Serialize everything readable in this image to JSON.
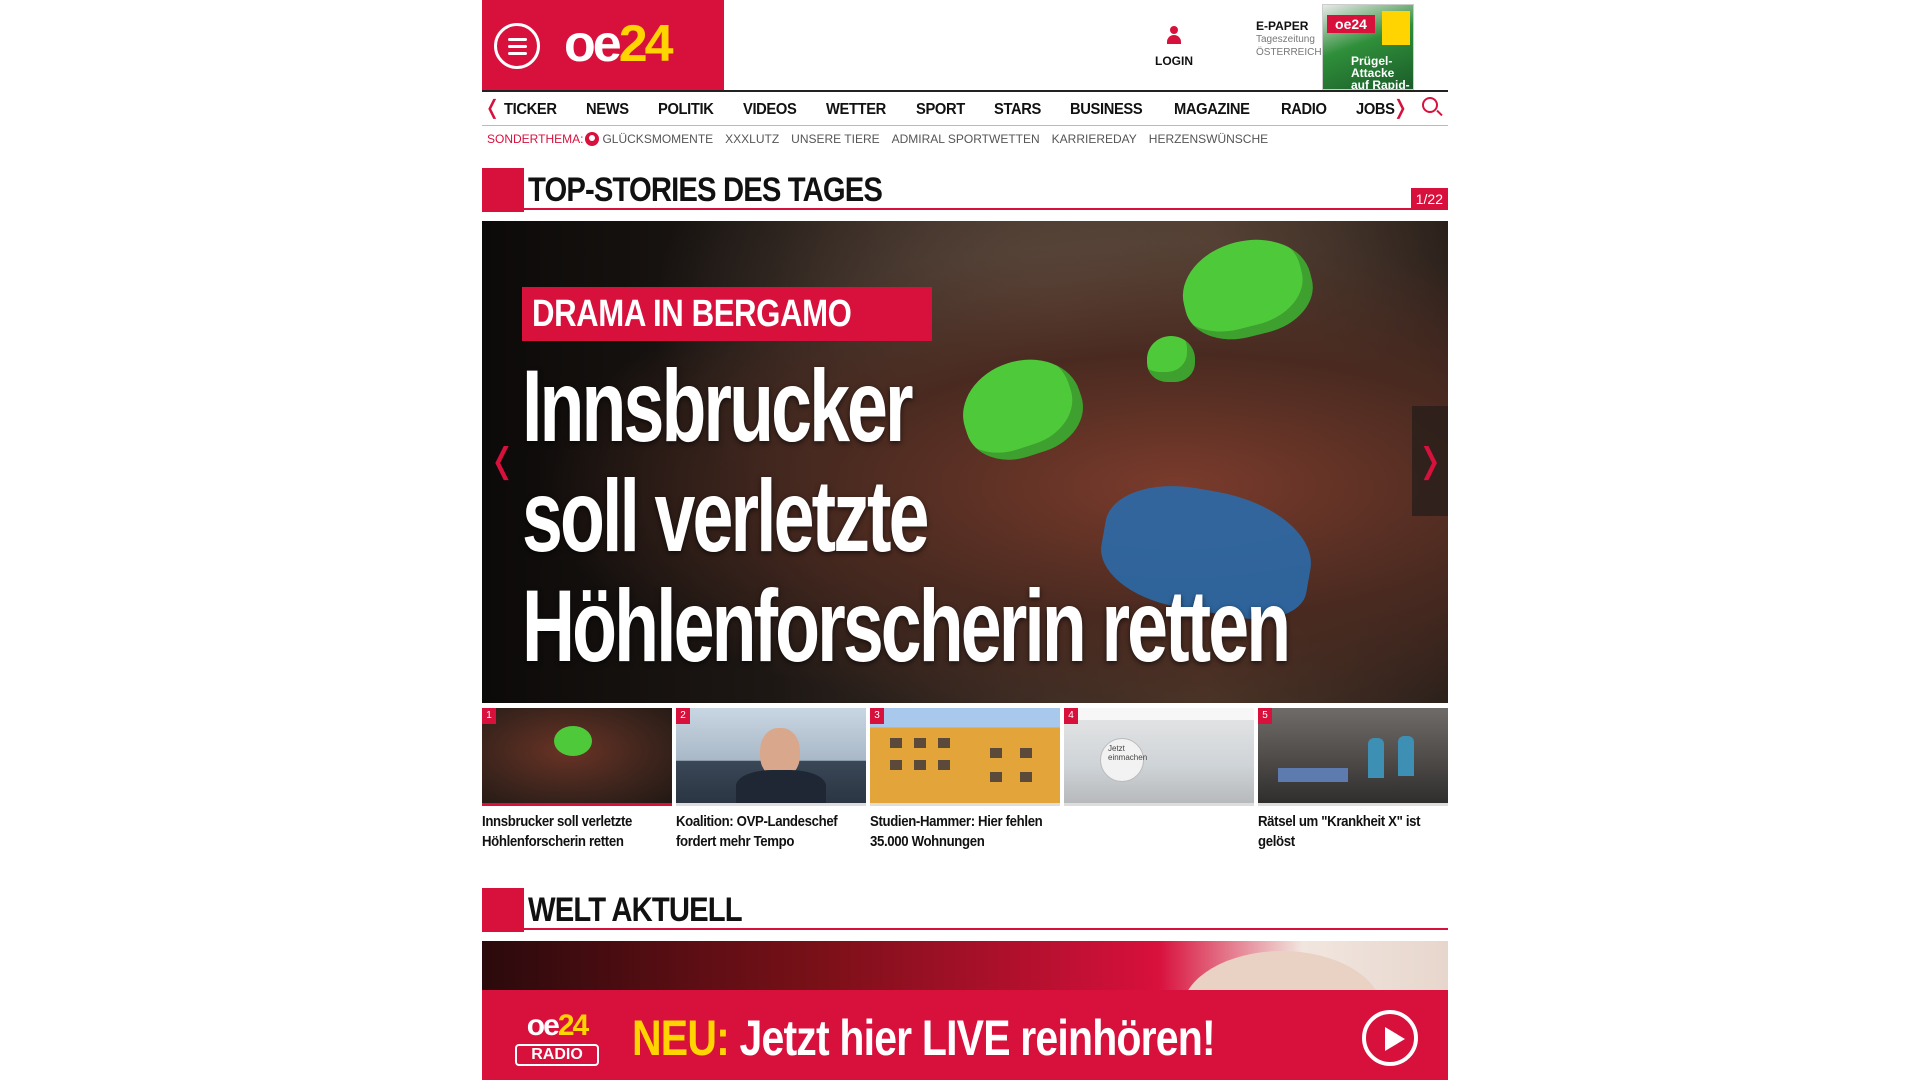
{
  "brand": {
    "logo_text": "oe",
    "logo_num": "24",
    "accent": "#d8103c",
    "logo_num_color": "#ffd400"
  },
  "header": {
    "menu_icon": "hamburger-menu-icon",
    "login_label": "LOGIN",
    "login_icon": "user-icon",
    "epaper": {
      "title": "E-PAPER",
      "subtitle": "Tageszeitung",
      "country": "ÖSTERREICH",
      "cover_mast": "oe24",
      "cover_headline": "Prügel-Attacke auf Rapid-Star"
    }
  },
  "nav": {
    "items": [
      "TICKER",
      "NEWS",
      "POLITIK",
      "VIDEOS",
      "WETTER",
      "SPORT",
      "STARS",
      "BUSINESS",
      "MAGAZINE",
      "RADIO",
      "JOBS"
    ],
    "prev_icon": "chevron-left-icon",
    "next_icon": "chevron-right-icon",
    "search_icon": "search-icon"
  },
  "subnav": {
    "label": "SONDERTHEMA:",
    "items": [
      "GLÜCKSMOMENTE",
      "XXXLUTZ",
      "UNSERE TIERE",
      "ADMIRAL SPORTWETTEN",
      "KARRIEREDAY",
      "HERZENSWÜNSCHE"
    ]
  },
  "top_stories": {
    "title": "TOP-STORIES DES TAGES",
    "counter": "1/22",
    "hero": {
      "kicker": "DRAMA IN BERGAMO",
      "title_lines": [
        "Innsbrucker",
        "soll verletzte",
        "Höhlenforscherin retten"
      ]
    },
    "thumbs": [
      {
        "num": "1",
        "caption_1": "Innsbrucker soll verletzte",
        "caption_2": "Höhlenforscherin retten"
      },
      {
        "num": "2",
        "caption_1": "Koalition: OVP-Landeschef",
        "caption_2": "fordert mehr Tempo"
      },
      {
        "num": "3",
        "caption_1": "Studien-Hammer: Hier fehlen",
        "caption_2": "35.000 Wohnungen"
      },
      {
        "num": "4",
        "caption_1": "",
        "caption_2": "",
        "image_text": "Jetzt einmachen"
      },
      {
        "num": "5",
        "caption_1": "Rätsel um \"Krankheit X\" ist",
        "caption_2": "gelöst"
      }
    ]
  },
  "welt": {
    "title": "WELT AKTUELL"
  },
  "radio_banner": {
    "logo_text": "oe",
    "logo_num": "24",
    "logo_badge": "RADIO",
    "neu": "NEU:",
    "text": " Jetzt hier LIVE reinhören!",
    "play_icon": "play-icon"
  }
}
